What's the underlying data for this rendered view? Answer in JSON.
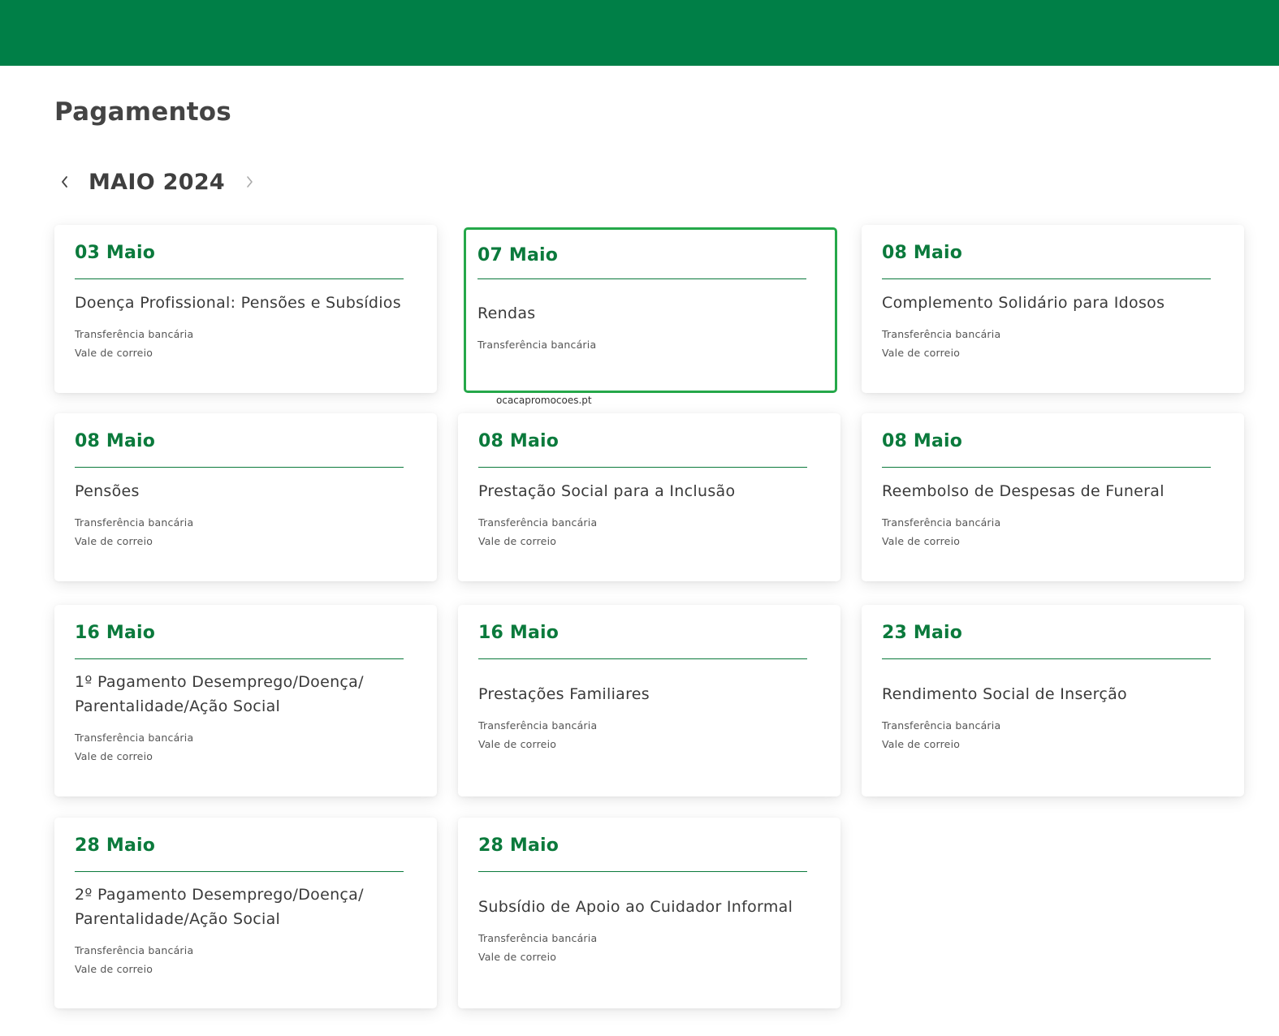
{
  "page": {
    "title": "Pagamentos",
    "accent_color": "#007f47",
    "selected_border_color": "#25a84a"
  },
  "calendar": {
    "month_label": "MAIO 2024",
    "prev_icon": "chevron-left-icon",
    "next_icon": "chevron-right-icon"
  },
  "payments": [
    {
      "date": "03 Maio",
      "title": "Doença Profissional: Pensões e Subsídios",
      "methods": [
        "Transferência bancária",
        "Vale de correio"
      ]
    },
    {
      "date": "07 Maio",
      "title": "Rendas",
      "methods": [
        "Transferência bancária"
      ],
      "selected": true
    },
    {
      "date": "08 Maio",
      "title": "Complemento Solidário para Idosos",
      "methods": [
        "Transferência bancária",
        "Vale de correio"
      ]
    },
    {
      "date": "08 Maio",
      "title": "Pensões",
      "methods": [
        "Transferência bancária",
        "Vale de correio"
      ]
    },
    {
      "date": "08 Maio",
      "title": "Prestação Social para a Inclusão",
      "methods": [
        "Transferência bancária",
        "Vale de correio"
      ]
    },
    {
      "date": "08 Maio",
      "title": "Reembolso de Despesas de Funeral",
      "methods": [
        "Transferência bancária",
        "Vale de correio"
      ]
    },
    {
      "date": "16 Maio",
      "title": "1º Pagamento Desemprego/Doença/ Parentalidade/Ação Social",
      "methods": [
        "Transferência bancária",
        "Vale de correio"
      ]
    },
    {
      "date": "16 Maio",
      "title": "Prestações Familiares",
      "methods": [
        "Transferência bancária",
        "Vale de correio"
      ]
    },
    {
      "date": "23 Maio",
      "title": "Rendimento Social de Inserção",
      "methods": [
        "Transferência bancária",
        "Vale de correio"
      ]
    },
    {
      "date": "28 Maio",
      "title": "2º Pagamento Desemprego/Doença/ Parentalidade/Ação Social",
      "methods": [
        "Transferência bancária",
        "Vale de correio"
      ]
    },
    {
      "date": "28 Maio",
      "title": "Subsídio de Apoio ao Cuidador Informal",
      "methods": [
        "Transferência bancária",
        "Vale de correio"
      ]
    }
  ],
  "watermark": "ocacapromocoes.pt"
}
